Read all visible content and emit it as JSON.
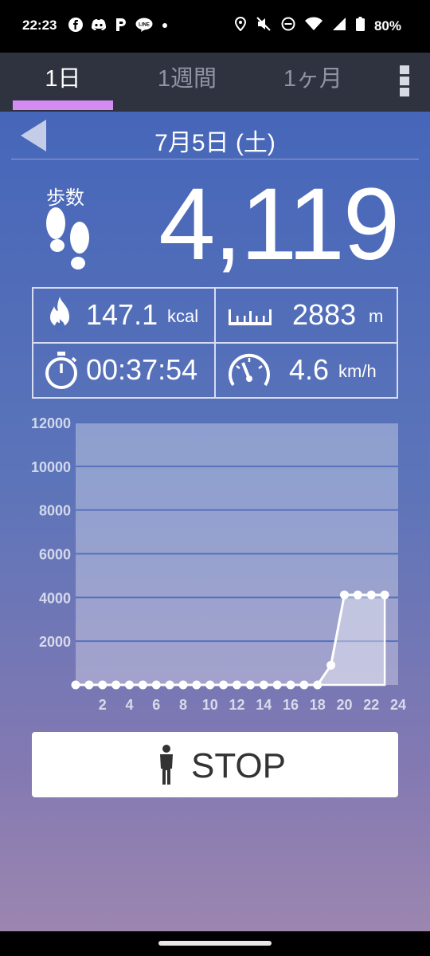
{
  "status_bar": {
    "time": "22:23",
    "battery": "80%",
    "left_icons": [
      "facebook-icon",
      "discord-icon",
      "p-icon",
      "line-icon",
      "dot-icon"
    ],
    "right_icons": [
      "location-icon",
      "mute-icon",
      "dnd-icon",
      "wifi-icon",
      "signal-icon",
      "battery-icon"
    ]
  },
  "tabs": [
    {
      "label": "1日",
      "active": true
    },
    {
      "label": "1週間",
      "active": false
    },
    {
      "label": "1ヶ月",
      "active": false
    }
  ],
  "date": {
    "label": "7月5日 (土)"
  },
  "steps": {
    "label": "歩数",
    "value": "4,119"
  },
  "stats": {
    "calories": {
      "value": "147.1",
      "unit": "kcal"
    },
    "distance": {
      "value": "2883",
      "unit": "m"
    },
    "time": {
      "value": "00:37:54"
    },
    "speed": {
      "value": "4.6",
      "unit": "km/h"
    }
  },
  "chart_data": {
    "type": "area",
    "x_ticks": [
      "2",
      "4",
      "6",
      "8",
      "10",
      "12",
      "14",
      "16",
      "18",
      "20",
      "22",
      "24"
    ],
    "y_ticks": [
      "12000",
      "10000",
      "8000",
      "6000",
      "4000",
      "2000"
    ],
    "xlim": [
      0,
      24
    ],
    "ylim": [
      0,
      12000
    ],
    "x": [
      0,
      1,
      2,
      3,
      4,
      5,
      6,
      7,
      8,
      9,
      10,
      11,
      12,
      13,
      14,
      15,
      16,
      17,
      18,
      19,
      20,
      21,
      22,
      23
    ],
    "values": [
      0,
      0,
      0,
      0,
      0,
      0,
      0,
      0,
      0,
      0,
      0,
      0,
      0,
      0,
      0,
      0,
      0,
      0,
      0,
      900,
      4119,
      4119,
      4119,
      4119
    ]
  },
  "stop_button": {
    "label": "STOP"
  },
  "colors": {
    "accent": "#d28cf2",
    "tab_bg": "#2f3340"
  }
}
